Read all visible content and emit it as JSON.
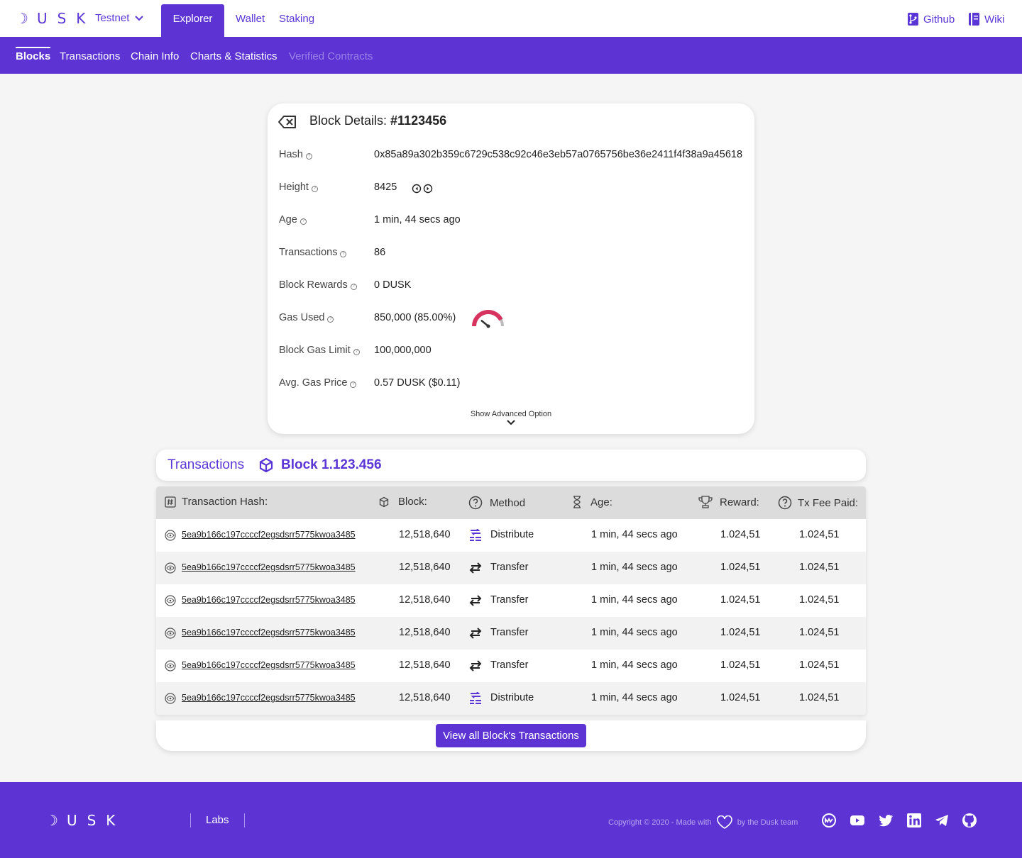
{
  "header": {
    "logo": "USK",
    "network": "Testnet",
    "tabs": [
      "Explorer",
      "Wallet",
      "Staking"
    ],
    "links": [
      "Github",
      "Wiki"
    ]
  },
  "subnav": [
    "Blocks",
    "Transactions",
    "Chain Info",
    "Charts & Statistics",
    "Verified Contracts"
  ],
  "details": {
    "title_prefix": "Block Details: ",
    "block_number": "#1123456",
    "rows": [
      {
        "label": "Hash",
        "value": "0x85a89a302b359c6729c538c92c46e3eb57a0765756be36e2411f4f38a9a45618"
      },
      {
        "label": "Height",
        "value": "8425"
      },
      {
        "label": "Age",
        "value": "1 min, 44 secs ago"
      },
      {
        "label": "Transactions",
        "value": "86"
      },
      {
        "label": "Block Rewards",
        "value": "0 DUSK"
      },
      {
        "label": "Gas Used",
        "value": "850,000 (85.00%)"
      },
      {
        "label": "Block Gas Limit",
        "value": "100,000,000"
      },
      {
        "label": "Avg. Gas Price",
        "value": "0.57 DUSK ($0.11)"
      }
    ],
    "gas_used_fraction": 0.85,
    "advanced_label": "Show Advanced Option"
  },
  "transactions": {
    "title": "Transactions",
    "block_label": "Block 1.123.456",
    "columns": [
      "Transaction Hash:",
      "Block:",
      "Method",
      "Age:",
      "Reward:",
      "Tx Fee Paid:"
    ],
    "rows": [
      {
        "hash": "5ea9b166c197ccccf2egsdsrr5775kwoa3485",
        "block": "12,518,640",
        "method": "Distribute",
        "age": "1 min, 44 secs ago",
        "reward": "1.024,51",
        "fee": "1.024,51"
      },
      {
        "hash": "5ea9b166c197ccccf2egsdsrr5775kwoa3485",
        "block": "12,518,640",
        "method": "Transfer",
        "age": "1 min, 44 secs ago",
        "reward": "1.024,51",
        "fee": "1.024,51"
      },
      {
        "hash": "5ea9b166c197ccccf2egsdsrr5775kwoa3485",
        "block": "12,518,640",
        "method": "Transfer",
        "age": "1 min, 44 secs ago",
        "reward": "1.024,51",
        "fee": "1.024,51"
      },
      {
        "hash": "5ea9b166c197ccccf2egsdsrr5775kwoa3485",
        "block": "12,518,640",
        "method": "Transfer",
        "age": "1 min, 44 secs ago",
        "reward": "1.024,51",
        "fee": "1.024,51"
      },
      {
        "hash": "5ea9b166c197ccccf2egsdsrr5775kwoa3485",
        "block": "12,518,640",
        "method": "Transfer",
        "age": "1 min, 44 secs ago",
        "reward": "1.024,51",
        "fee": "1.024,51"
      },
      {
        "hash": "5ea9b166c197ccccf2egsdsrr5775kwoa3485",
        "block": "12,518,640",
        "method": "Distribute",
        "age": "1 min, 44 secs ago",
        "reward": "1.024,51",
        "fee": "1.024,51"
      }
    ],
    "view_all_label": "View all Block's Transactions"
  },
  "footer": {
    "logo": "USK",
    "labs": "Labs",
    "copyright_prefix": "Copyright © 2020  - Made with",
    "copyright_suffix": "by the Dusk team",
    "social_icons": [
      "coinmarketcap-icon",
      "youtube-icon",
      "twitter-icon",
      "linkedin-icon",
      "telegram-icon",
      "github-icon"
    ]
  },
  "colors": {
    "brand": "#5d34d3",
    "gauge": "#d6335f"
  }
}
